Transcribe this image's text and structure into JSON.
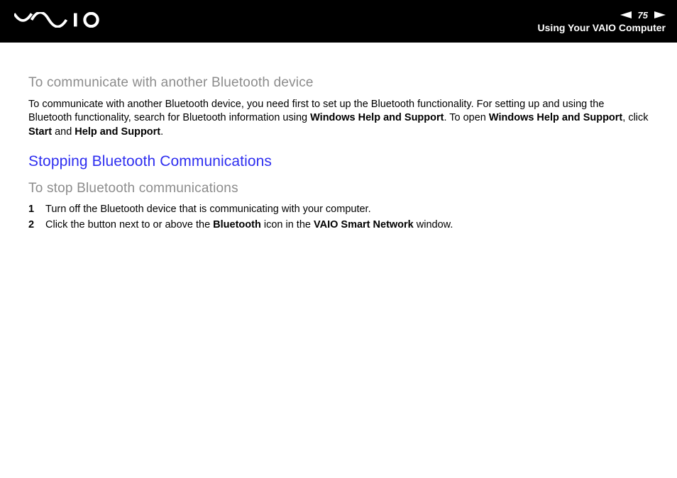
{
  "header": {
    "brand": "VAIO",
    "page_number": "75",
    "section": "Using Your VAIO Computer"
  },
  "content": {
    "subhead1": "To communicate with another Bluetooth device",
    "paragraph1_pre": "To communicate with another Bluetooth device, you need first to set up the Bluetooth functionality. For setting up and using the Bluetooth functionality, search for Bluetooth information using ",
    "bold_whs": "Windows Help and Support",
    "paragraph1_mid": ". To open ",
    "bold_whs2": "Windows Help and Support",
    "paragraph1_click": ", click ",
    "bold_start": "Start",
    "paragraph1_and": " and ",
    "bold_has": "Help and Support",
    "paragraph1_end": ".",
    "section_head": "Stopping Bluetooth Communications",
    "subhead2": "To stop Bluetooth communications",
    "steps": [
      {
        "num": "1",
        "text": "Turn off the Bluetooth device that is communicating with your computer."
      },
      {
        "num": "2",
        "pre": "Click the button next to or above the ",
        "bold_bt": "Bluetooth",
        "mid": " icon in the ",
        "bold_vsn": "VAIO Smart Network",
        "post": " window."
      }
    ]
  }
}
